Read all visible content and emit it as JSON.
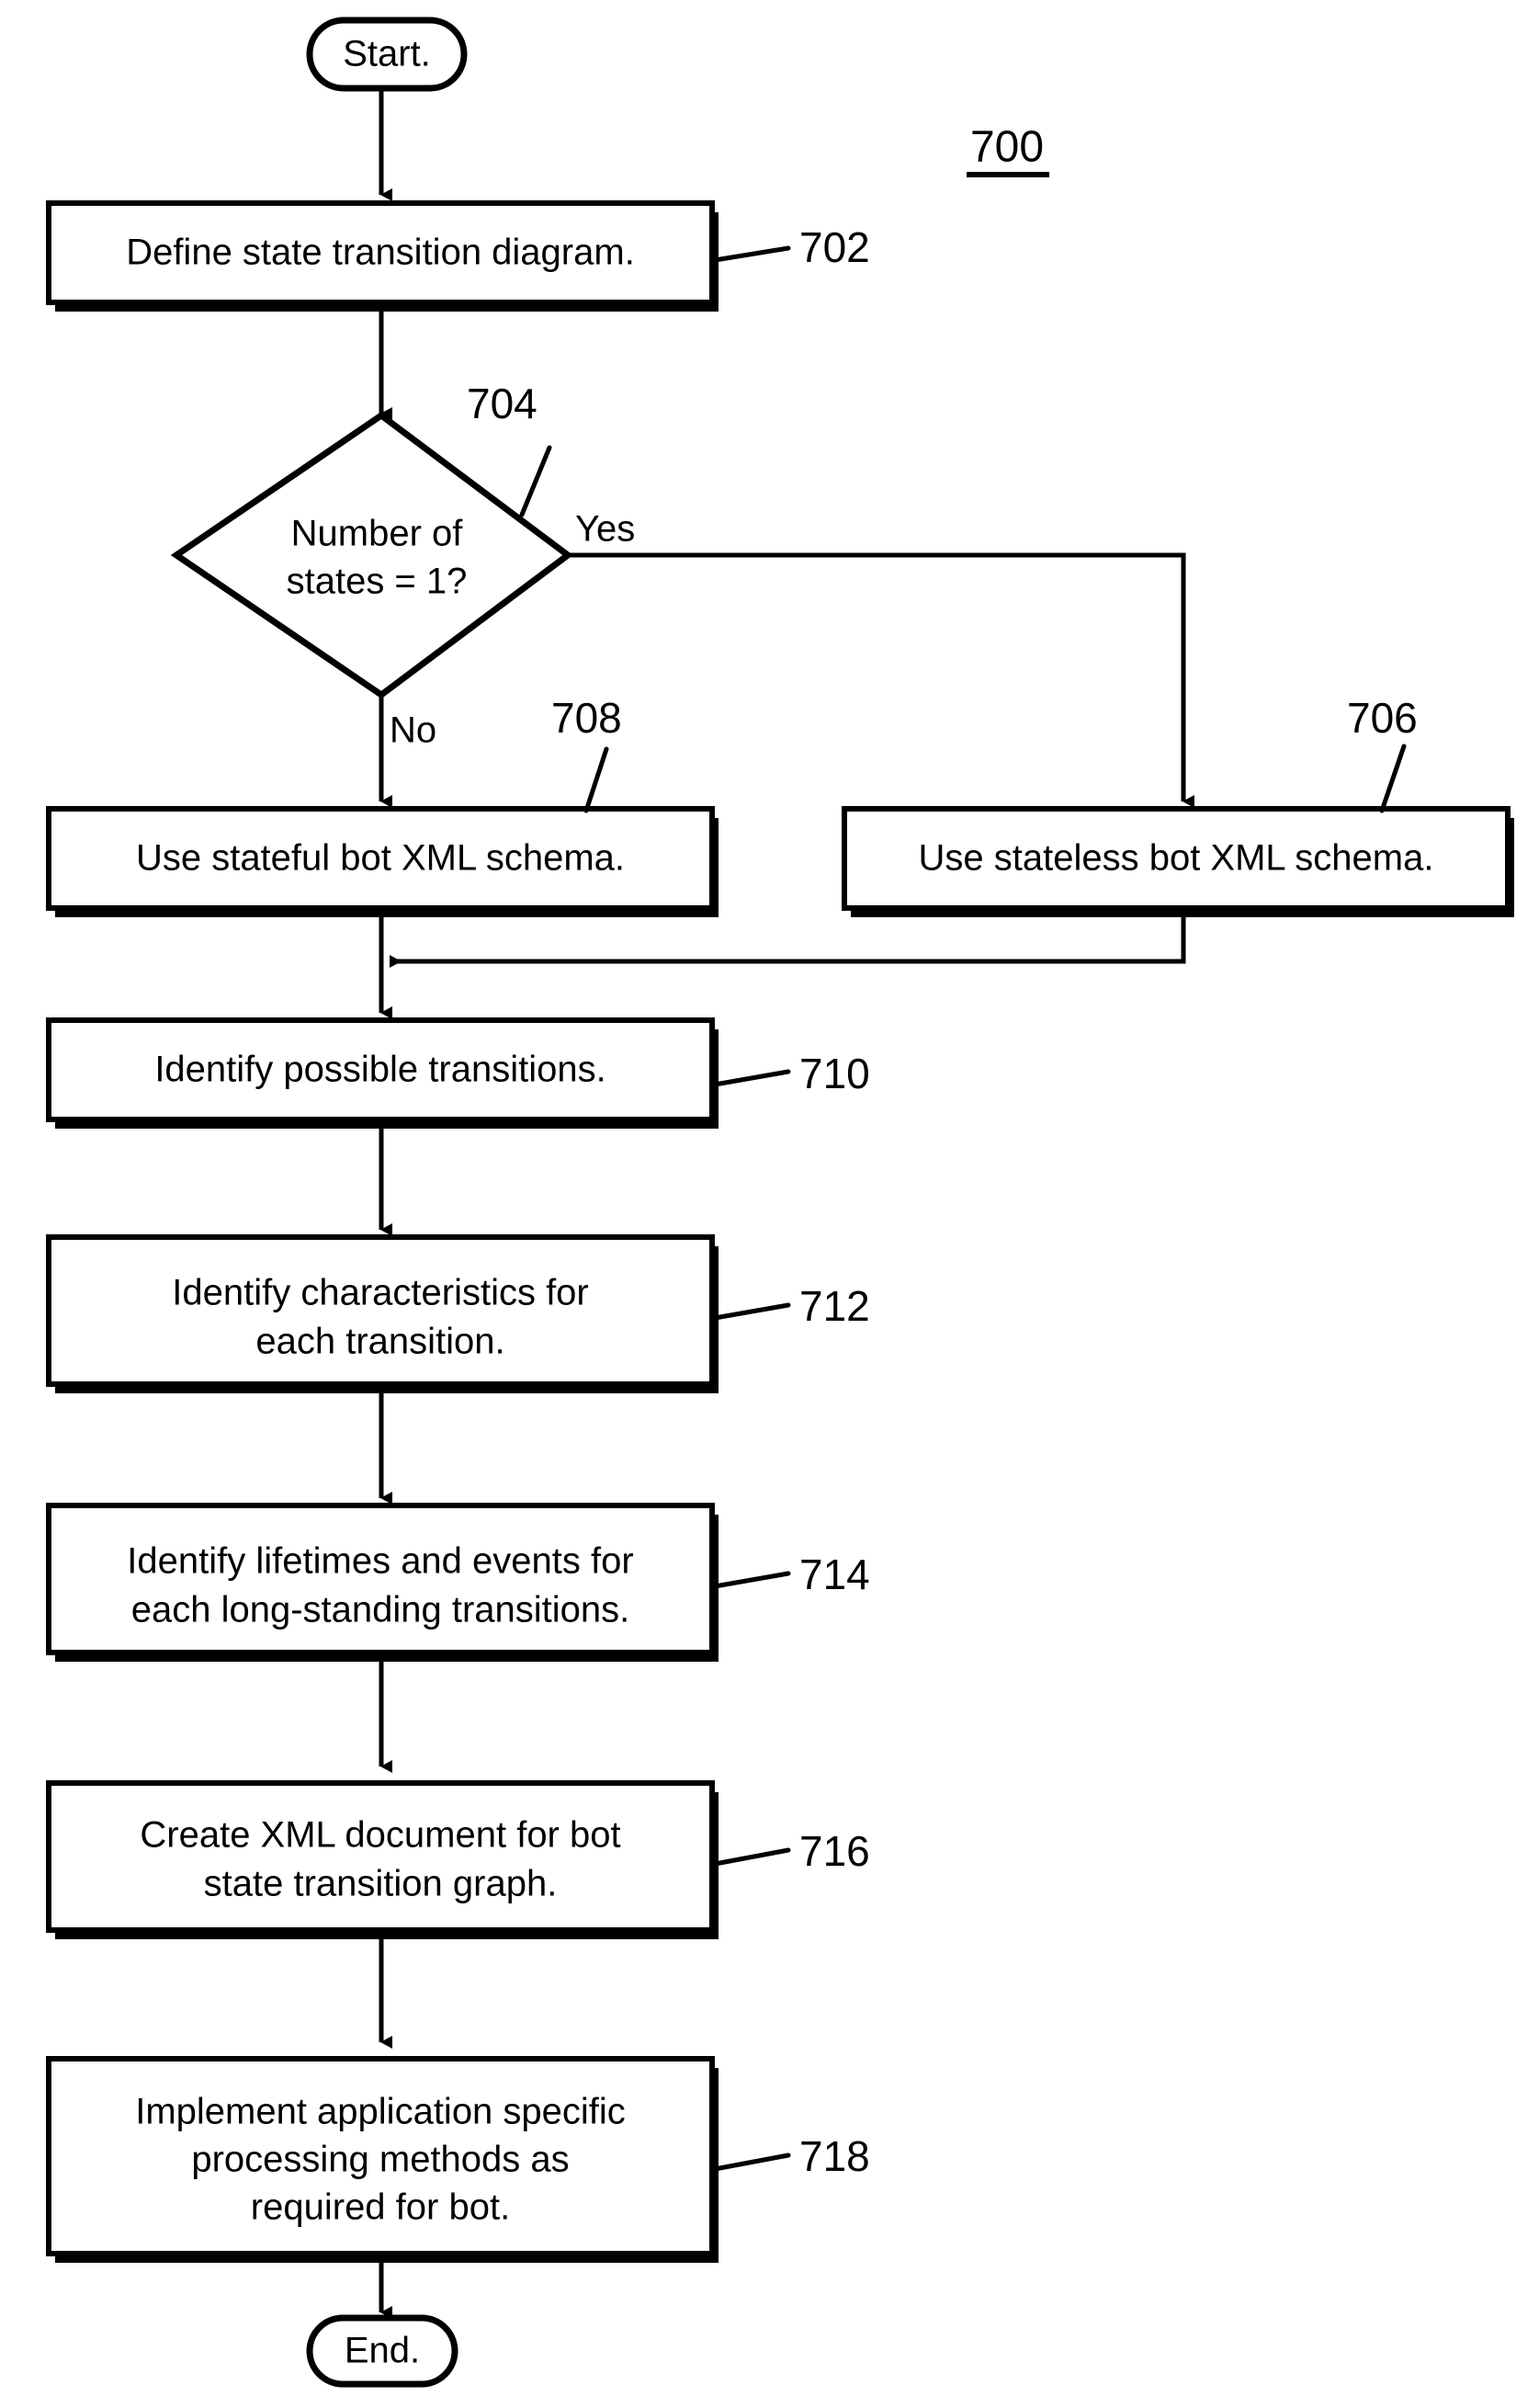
{
  "figure": {
    "number": "700",
    "type": "flowchart"
  },
  "terminators": {
    "start": "Start.",
    "end": "End."
  },
  "branch_labels": {
    "yes": "Yes",
    "no": "No"
  },
  "nodes": [
    {
      "ref": "702",
      "shape": "process",
      "lines": [
        "Define state transition diagram."
      ]
    },
    {
      "ref": "704",
      "shape": "decision",
      "lines": [
        "Number of",
        "states = 1?"
      ]
    },
    {
      "ref": "706",
      "shape": "process",
      "lines": [
        "Use stateless bot XML schema."
      ]
    },
    {
      "ref": "708",
      "shape": "process",
      "lines": [
        "Use stateful bot XML schema."
      ]
    },
    {
      "ref": "710",
      "shape": "process",
      "lines": [
        "Identify possible transitions."
      ]
    },
    {
      "ref": "712",
      "shape": "process",
      "lines": [
        "Identify characteristics for",
        "each transition."
      ]
    },
    {
      "ref": "714",
      "shape": "process",
      "lines": [
        "Identify lifetimes and events for",
        "each long-standing transitions."
      ]
    },
    {
      "ref": "716",
      "shape": "process",
      "lines": [
        "Create XML document for bot",
        "state transition graph."
      ]
    },
    {
      "ref": "718",
      "shape": "process",
      "lines": [
        "Implement application specific",
        "processing methods as",
        "required for bot."
      ]
    }
  ],
  "colors": {
    "ink": "#000000",
    "paper": "#ffffff"
  }
}
